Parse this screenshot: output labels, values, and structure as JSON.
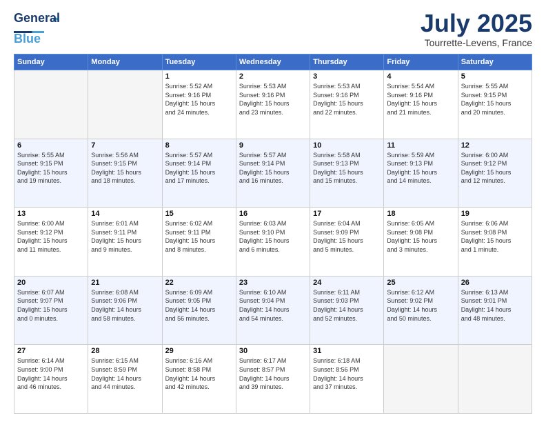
{
  "logo": {
    "line1": "General",
    "line2": "Blue"
  },
  "title": "July 2025",
  "location": "Tourrette-Levens, France",
  "days_header": [
    "Sunday",
    "Monday",
    "Tuesday",
    "Wednesday",
    "Thursday",
    "Friday",
    "Saturday"
  ],
  "weeks": [
    [
      {
        "day": "",
        "info": ""
      },
      {
        "day": "",
        "info": ""
      },
      {
        "day": "1",
        "info": "Sunrise: 5:52 AM\nSunset: 9:16 PM\nDaylight: 15 hours\nand 24 minutes."
      },
      {
        "day": "2",
        "info": "Sunrise: 5:53 AM\nSunset: 9:16 PM\nDaylight: 15 hours\nand 23 minutes."
      },
      {
        "day": "3",
        "info": "Sunrise: 5:53 AM\nSunset: 9:16 PM\nDaylight: 15 hours\nand 22 minutes."
      },
      {
        "day": "4",
        "info": "Sunrise: 5:54 AM\nSunset: 9:16 PM\nDaylight: 15 hours\nand 21 minutes."
      },
      {
        "day": "5",
        "info": "Sunrise: 5:55 AM\nSunset: 9:15 PM\nDaylight: 15 hours\nand 20 minutes."
      }
    ],
    [
      {
        "day": "6",
        "info": "Sunrise: 5:55 AM\nSunset: 9:15 PM\nDaylight: 15 hours\nand 19 minutes."
      },
      {
        "day": "7",
        "info": "Sunrise: 5:56 AM\nSunset: 9:15 PM\nDaylight: 15 hours\nand 18 minutes."
      },
      {
        "day": "8",
        "info": "Sunrise: 5:57 AM\nSunset: 9:14 PM\nDaylight: 15 hours\nand 17 minutes."
      },
      {
        "day": "9",
        "info": "Sunrise: 5:57 AM\nSunset: 9:14 PM\nDaylight: 15 hours\nand 16 minutes."
      },
      {
        "day": "10",
        "info": "Sunrise: 5:58 AM\nSunset: 9:13 PM\nDaylight: 15 hours\nand 15 minutes."
      },
      {
        "day": "11",
        "info": "Sunrise: 5:59 AM\nSunset: 9:13 PM\nDaylight: 15 hours\nand 14 minutes."
      },
      {
        "day": "12",
        "info": "Sunrise: 6:00 AM\nSunset: 9:12 PM\nDaylight: 15 hours\nand 12 minutes."
      }
    ],
    [
      {
        "day": "13",
        "info": "Sunrise: 6:00 AM\nSunset: 9:12 PM\nDaylight: 15 hours\nand 11 minutes."
      },
      {
        "day": "14",
        "info": "Sunrise: 6:01 AM\nSunset: 9:11 PM\nDaylight: 15 hours\nand 9 minutes."
      },
      {
        "day": "15",
        "info": "Sunrise: 6:02 AM\nSunset: 9:11 PM\nDaylight: 15 hours\nand 8 minutes."
      },
      {
        "day": "16",
        "info": "Sunrise: 6:03 AM\nSunset: 9:10 PM\nDaylight: 15 hours\nand 6 minutes."
      },
      {
        "day": "17",
        "info": "Sunrise: 6:04 AM\nSunset: 9:09 PM\nDaylight: 15 hours\nand 5 minutes."
      },
      {
        "day": "18",
        "info": "Sunrise: 6:05 AM\nSunset: 9:08 PM\nDaylight: 15 hours\nand 3 minutes."
      },
      {
        "day": "19",
        "info": "Sunrise: 6:06 AM\nSunset: 9:08 PM\nDaylight: 15 hours\nand 1 minute."
      }
    ],
    [
      {
        "day": "20",
        "info": "Sunrise: 6:07 AM\nSunset: 9:07 PM\nDaylight: 15 hours\nand 0 minutes."
      },
      {
        "day": "21",
        "info": "Sunrise: 6:08 AM\nSunset: 9:06 PM\nDaylight: 14 hours\nand 58 minutes."
      },
      {
        "day": "22",
        "info": "Sunrise: 6:09 AM\nSunset: 9:05 PM\nDaylight: 14 hours\nand 56 minutes."
      },
      {
        "day": "23",
        "info": "Sunrise: 6:10 AM\nSunset: 9:04 PM\nDaylight: 14 hours\nand 54 minutes."
      },
      {
        "day": "24",
        "info": "Sunrise: 6:11 AM\nSunset: 9:03 PM\nDaylight: 14 hours\nand 52 minutes."
      },
      {
        "day": "25",
        "info": "Sunrise: 6:12 AM\nSunset: 9:02 PM\nDaylight: 14 hours\nand 50 minutes."
      },
      {
        "day": "26",
        "info": "Sunrise: 6:13 AM\nSunset: 9:01 PM\nDaylight: 14 hours\nand 48 minutes."
      }
    ],
    [
      {
        "day": "27",
        "info": "Sunrise: 6:14 AM\nSunset: 9:00 PM\nDaylight: 14 hours\nand 46 minutes."
      },
      {
        "day": "28",
        "info": "Sunrise: 6:15 AM\nSunset: 8:59 PM\nDaylight: 14 hours\nand 44 minutes."
      },
      {
        "day": "29",
        "info": "Sunrise: 6:16 AM\nSunset: 8:58 PM\nDaylight: 14 hours\nand 42 minutes."
      },
      {
        "day": "30",
        "info": "Sunrise: 6:17 AM\nSunset: 8:57 PM\nDaylight: 14 hours\nand 39 minutes."
      },
      {
        "day": "31",
        "info": "Sunrise: 6:18 AM\nSunset: 8:56 PM\nDaylight: 14 hours\nand 37 minutes."
      },
      {
        "day": "",
        "info": ""
      },
      {
        "day": "",
        "info": ""
      }
    ]
  ]
}
